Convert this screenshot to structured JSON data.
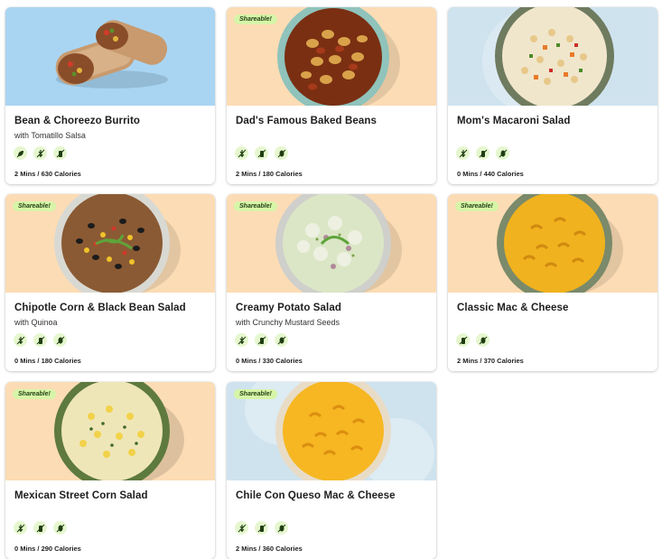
{
  "badge_label": "Shareable!",
  "cards": [
    {
      "title": "Bean & Choreezo Burrito",
      "subtitle": "with Tomatillo Salsa",
      "meta": "2 Mins / 630 Calories",
      "icons": [
        "leaf-icon",
        "no-gluten-icon",
        "no-dairy-icon"
      ],
      "shareable": false
    },
    {
      "title": "Dad's Famous Baked Beans",
      "subtitle": "",
      "meta": "2 Mins / 180 Calories",
      "icons": [
        "no-gluten-icon",
        "no-dairy-icon",
        "no-nut-icon"
      ],
      "shareable": true
    },
    {
      "title": "Mom's Macaroni Salad",
      "subtitle": "",
      "meta": "0 Mins / 440 Calories",
      "icons": [
        "no-gluten-icon",
        "no-dairy-icon",
        "no-nut-icon"
      ],
      "shareable": false
    },
    {
      "title": "Chipotle Corn & Black Bean Salad",
      "subtitle": "with Quinoa",
      "meta": "0 Mins / 180 Calories",
      "icons": [
        "no-gluten-icon",
        "no-dairy-icon",
        "no-nut-icon"
      ],
      "shareable": true
    },
    {
      "title": "Creamy Potato Salad",
      "subtitle": "with Crunchy Mustard Seeds",
      "meta": "0 Mins / 330 Calories",
      "icons": [
        "no-gluten-icon",
        "no-dairy-icon",
        "no-nut-icon"
      ],
      "shareable": true
    },
    {
      "title": "Classic Mac & Cheese",
      "subtitle": "",
      "meta": "2 Mins / 370 Calories",
      "icons": [
        "no-dairy-icon",
        "no-nut-icon"
      ],
      "shareable": true
    },
    {
      "title": "Mexican Street Corn Salad",
      "subtitle": "",
      "meta": "0 Mins / 290 Calories",
      "icons": [
        "no-gluten-icon",
        "no-dairy-icon",
        "no-nut-icon"
      ],
      "shareable": true
    },
    {
      "title": "Chile Con Queso Mac & Cheese",
      "subtitle": "",
      "meta": "2 Mins / 360 Calories",
      "icons": [
        "no-gluten-icon",
        "no-dairy-icon",
        "no-nut-icon"
      ],
      "shareable": true
    }
  ],
  "colors": {
    "icon_bg": "#e6f7cf",
    "icon_fg": "#1f3d12",
    "badge_bg": "#d7f5a8",
    "peach_bg": "#fcdcb4",
    "blue_bg": "#a9d5f3",
    "ice_bg": "#cfe3ee"
  }
}
